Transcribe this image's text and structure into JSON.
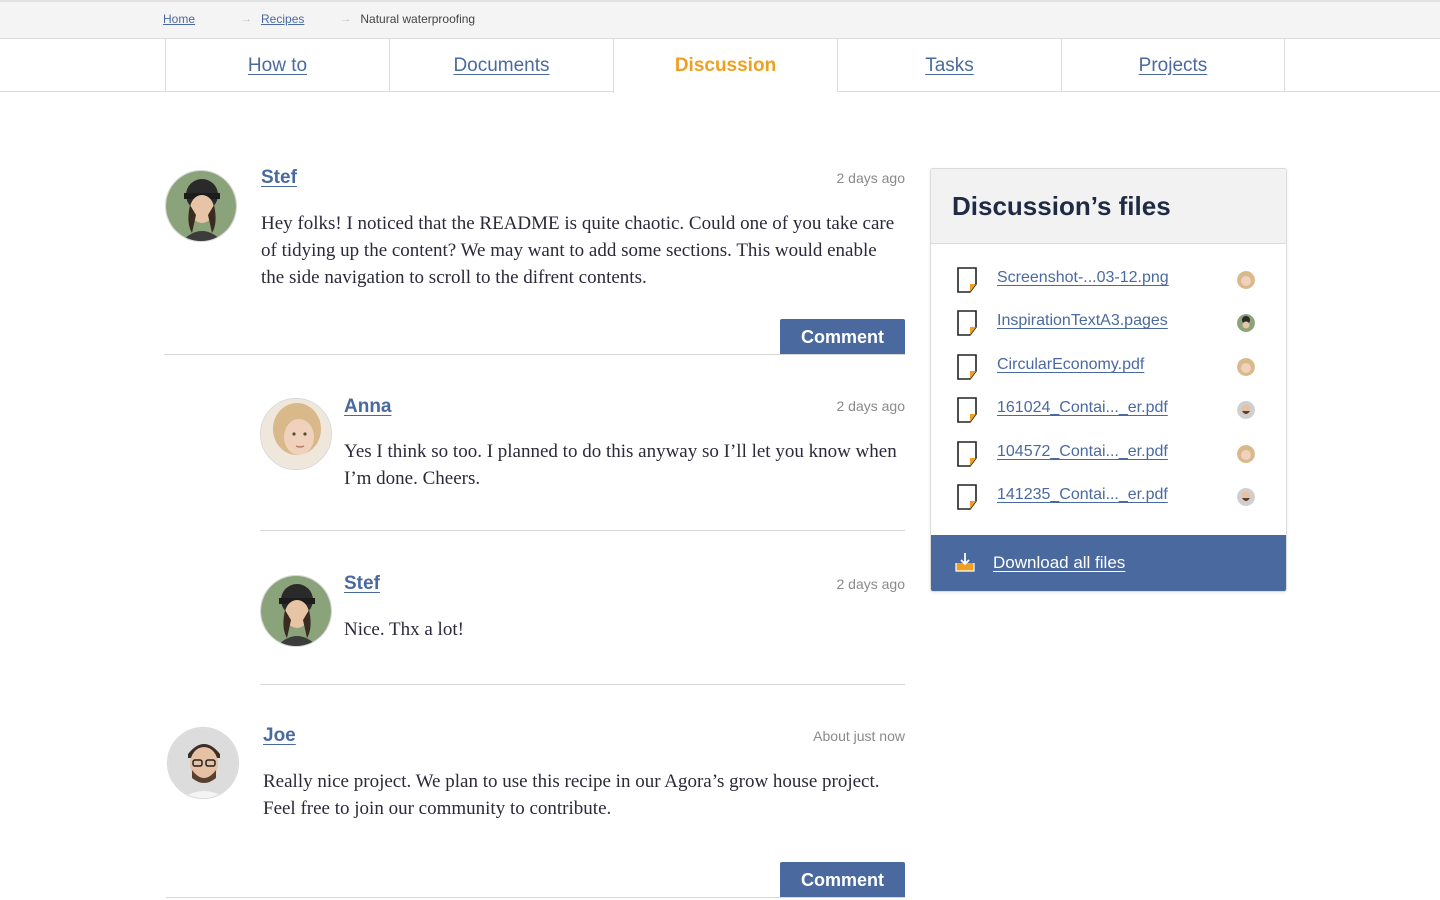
{
  "breadcrumb": {
    "home": "Home",
    "recipes": "Recipes",
    "current": "Natural waterproofing"
  },
  "tabs": [
    {
      "label": "How to",
      "active": false
    },
    {
      "label": "Documents",
      "active": false
    },
    {
      "label": "Discussion",
      "active": true
    },
    {
      "label": "Tasks",
      "active": false
    },
    {
      "label": "Projects",
      "active": false
    }
  ],
  "comments": [
    {
      "author": "Stef",
      "time": "2 days ago",
      "text": "Hey folks! I noticed that the README is quite chaotic. Could one of you take care of tidying up the content? We may want to add some sections. This would enable the side navigation to scroll to the difrent contents.",
      "button": "Comment"
    },
    {
      "author": "Anna",
      "time": "2 days ago",
      "text": "Yes I think so too. I planned to do this anyway so I’ll let you know when I’m done. Cheers."
    },
    {
      "author": "Stef",
      "time": "2 days ago",
      "text": "Nice. Thx a lot!"
    },
    {
      "author": "Joe",
      "time": "About just now",
      "text": "Really nice project. We plan to use this recipe in our Agora’s grow house project. Feel free to join our community to contribute.",
      "button": "Comment"
    }
  ],
  "files_panel": {
    "title": "Discussion’s files",
    "files": [
      {
        "name": "Screenshot-...03-12.png",
        "owner": "Anna"
      },
      {
        "name": "InspirationTextA3.pages",
        "owner": "Stef"
      },
      {
        "name": "CircularEconomy.pdf",
        "owner": "Anna"
      },
      {
        "name": "161024_Contai..._er.pdf",
        "owner": "Joe"
      },
      {
        "name": "104572_Contai..._er.pdf",
        "owner": "Anna"
      },
      {
        "name": "141235_Contai..._er.pdf",
        "owner": "Joe"
      }
    ],
    "download_label": "Download all files"
  },
  "colors": {
    "link": "#4a6a9f",
    "accent": "#efa020",
    "button": "#4a6a9f",
    "title": "#1f2a44"
  }
}
